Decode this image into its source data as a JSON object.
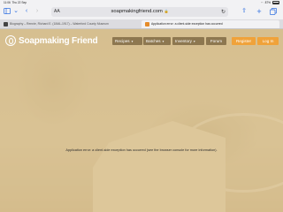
{
  "status_bar": {
    "time": "11:06",
    "date": "Thu 22 Sep",
    "battery": "87%",
    "battery_level": 0.87
  },
  "browser": {
    "address_text_size": "AA",
    "url": "soapmakingfriend.com",
    "tabs": [
      {
        "title": "Biography – Rennie, Richard E. (1846–1917) – Waterford County Museum",
        "active": false
      },
      {
        "title": "Application error: a client-side exception has occurred",
        "active": true
      }
    ]
  },
  "site": {
    "brand": "Soapmaking Friend",
    "nav": [
      {
        "label": "Recipes",
        "has_dropdown": true
      },
      {
        "label": "Batches",
        "has_dropdown": true
      },
      {
        "label": "Inventory",
        "has_dropdown": true
      },
      {
        "label": "Forum",
        "has_dropdown": false
      }
    ],
    "register_label": "Register",
    "login_label": "Log In",
    "accent_color": "#f0a23a"
  },
  "error_message": "Application error: a client-side exception has occurred (see the browser console for more information)."
}
